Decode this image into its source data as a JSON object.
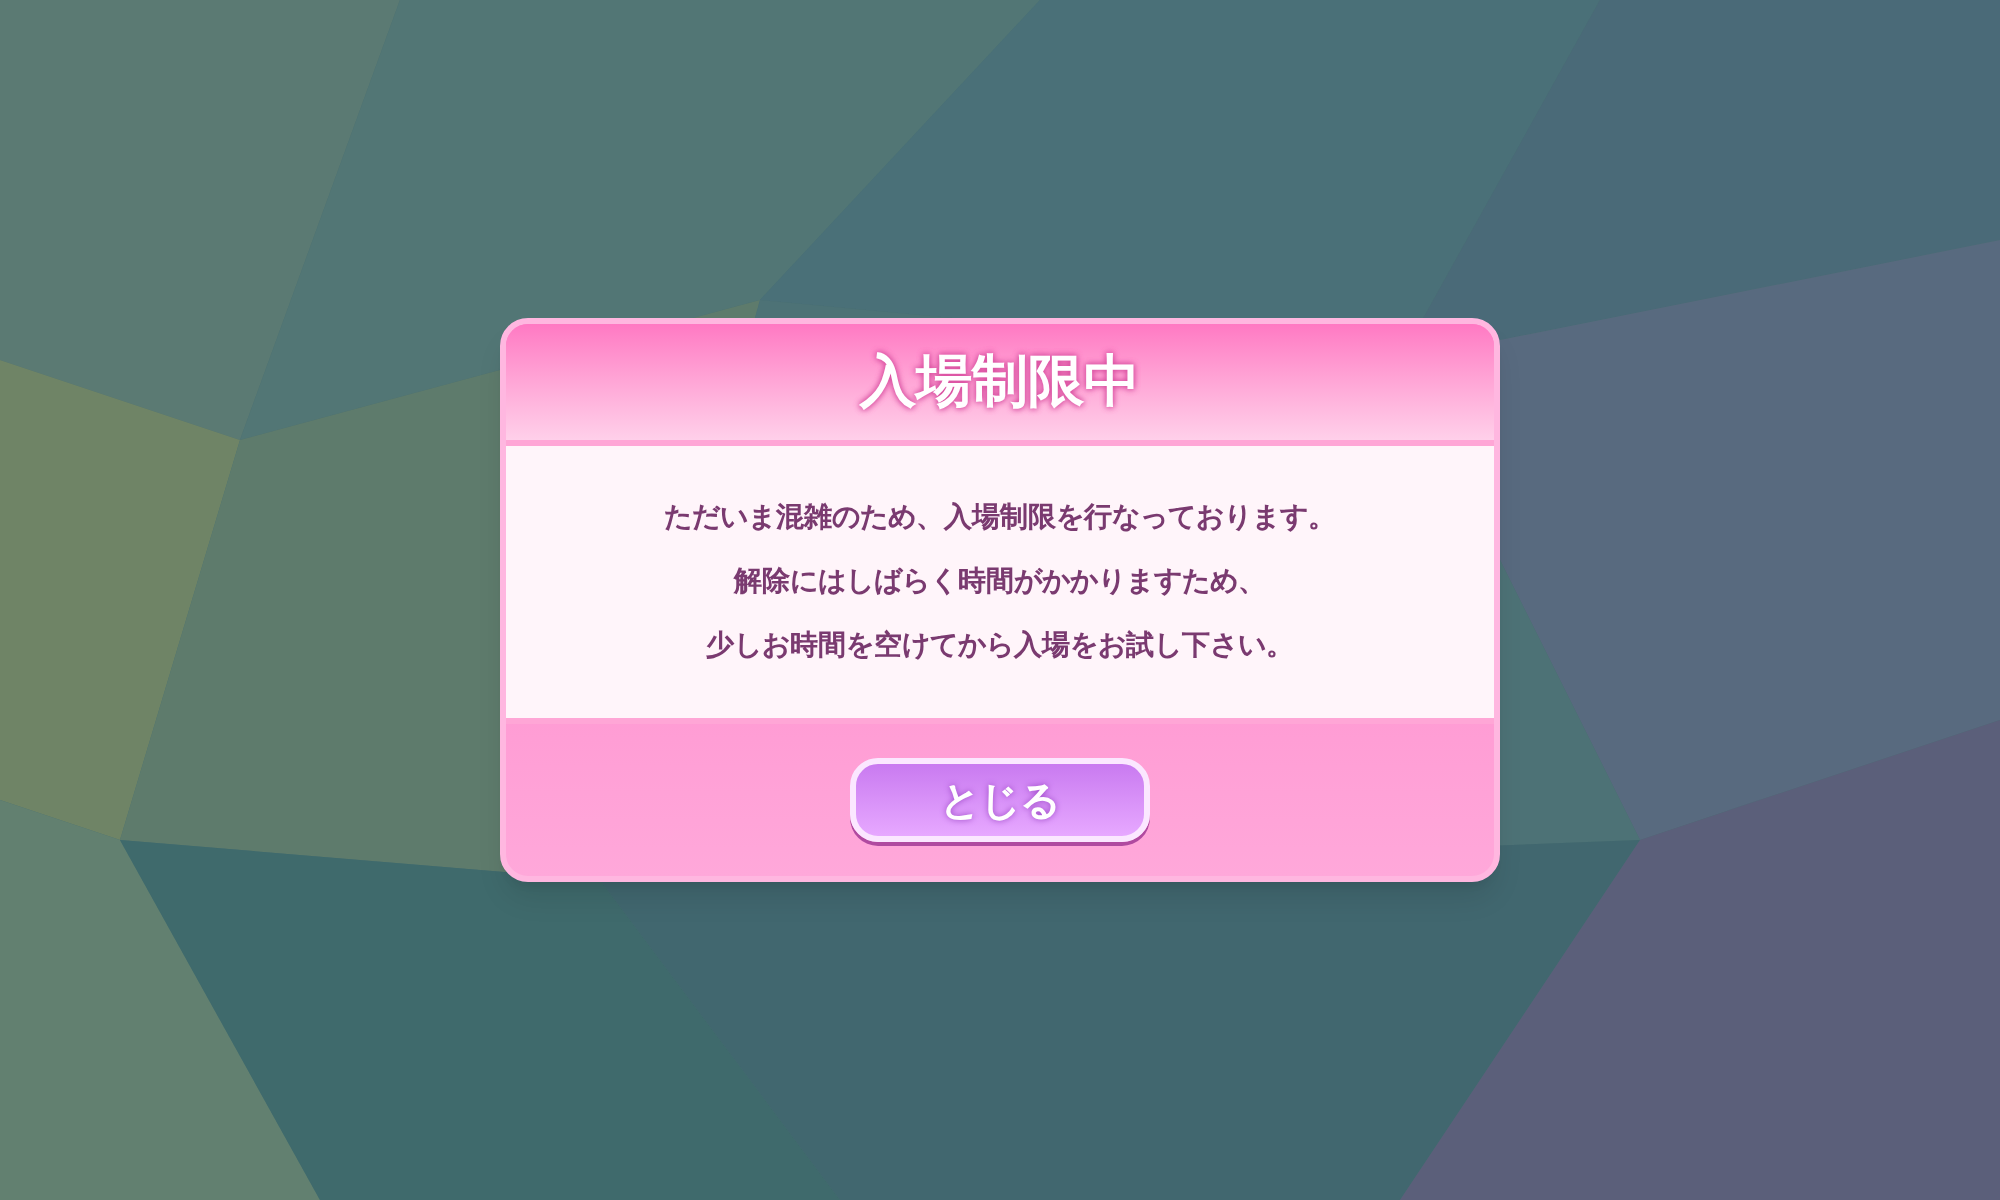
{
  "dialog": {
    "title": "入場制限中",
    "message_lines": [
      "ただいま混雑のため、入場制限を行なっております。",
      "解除にはしばらく時間がかかりますため、",
      "少しお時間を空けてから入場をお試し下さい。"
    ],
    "buttons": [
      {
        "label": "とじる"
      }
    ]
  }
}
